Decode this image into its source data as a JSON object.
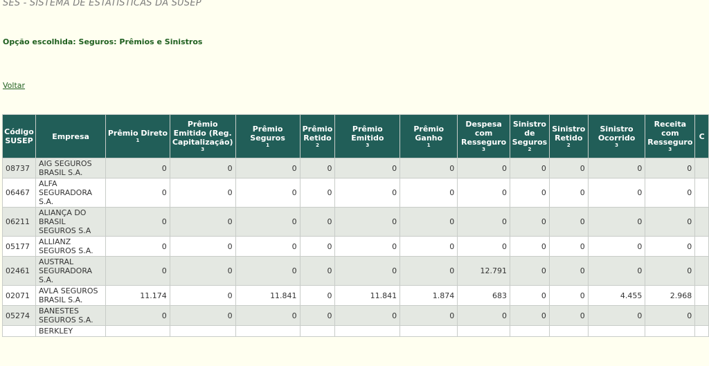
{
  "header": {
    "title": "SES - SISTEMA DE ESTATÍSTICAS DA SUSEP",
    "option_text": "Opção escolhida: Seguros: Prêmios e Sinistros",
    "back_link": "Voltar"
  },
  "table": {
    "columns": [
      {
        "label": "Código SUSEP",
        "note": ""
      },
      {
        "label": "Empresa",
        "note": ""
      },
      {
        "label": "Prêmio Direto",
        "note": "1"
      },
      {
        "label": "Prêmio Emitido (Reg. Capitalização)",
        "note": "3"
      },
      {
        "label": "Prêmio Seguros",
        "note": "1"
      },
      {
        "label": "Prêmio Retido",
        "note": "2"
      },
      {
        "label": "Prêmio Emitido",
        "note": "3"
      },
      {
        "label": "Prêmio Ganho",
        "note": "1"
      },
      {
        "label": "Despesa com Resseguro",
        "note": "3"
      },
      {
        "label": "Sinistro de Seguros",
        "note": "2"
      },
      {
        "label": "Sinistro Retido",
        "note": "2"
      },
      {
        "label": "Sinistro Ocorrido",
        "note": "3"
      },
      {
        "label": "Receita com Resseguro",
        "note": "3"
      },
      {
        "label": "C",
        "note": ""
      }
    ],
    "rows": [
      {
        "code": "08737",
        "company": "AIG SEGUROS BRASIL S.A.",
        "values": [
          "0",
          "0",
          "0",
          "0",
          "0",
          "0",
          "0",
          "0",
          "0",
          "0",
          "0"
        ]
      },
      {
        "code": "06467",
        "company": "ALFA SEGURADORA S.A.",
        "values": [
          "0",
          "0",
          "0",
          "0",
          "0",
          "0",
          "0",
          "0",
          "0",
          "0",
          "0"
        ]
      },
      {
        "code": "06211",
        "company": "ALIANÇA DO BRASIL SEGUROS S.A",
        "values": [
          "0",
          "0",
          "0",
          "0",
          "0",
          "0",
          "0",
          "0",
          "0",
          "0",
          "0"
        ]
      },
      {
        "code": "05177",
        "company": "ALLIANZ SEGUROS S.A.",
        "values": [
          "0",
          "0",
          "0",
          "0",
          "0",
          "0",
          "0",
          "0",
          "0",
          "0",
          "0"
        ]
      },
      {
        "code": "02461",
        "company": "AUSTRAL SEGURADORA S.A.",
        "values": [
          "0",
          "0",
          "0",
          "0",
          "0",
          "0",
          "12.791",
          "0",
          "0",
          "0",
          "0"
        ]
      },
      {
        "code": "02071",
        "company": "AVLA SEGUROS BRASIL S.A.",
        "values": [
          "11.174",
          "0",
          "11.841",
          "0",
          "11.841",
          "1.874",
          "683",
          "0",
          "0",
          "4.455",
          "2.968"
        ]
      },
      {
        "code": "05274",
        "company": "BANESTES SEGUROS S.A.",
        "values": [
          "0",
          "0",
          "0",
          "0",
          "0",
          "0",
          "0",
          "0",
          "0",
          "0",
          "0"
        ]
      },
      {
        "code": "",
        "company": "BERKLEY",
        "values": [
          "",
          "",
          "",
          "",
          "",
          "",
          "",
          "",
          "",
          "",
          ""
        ]
      }
    ]
  }
}
